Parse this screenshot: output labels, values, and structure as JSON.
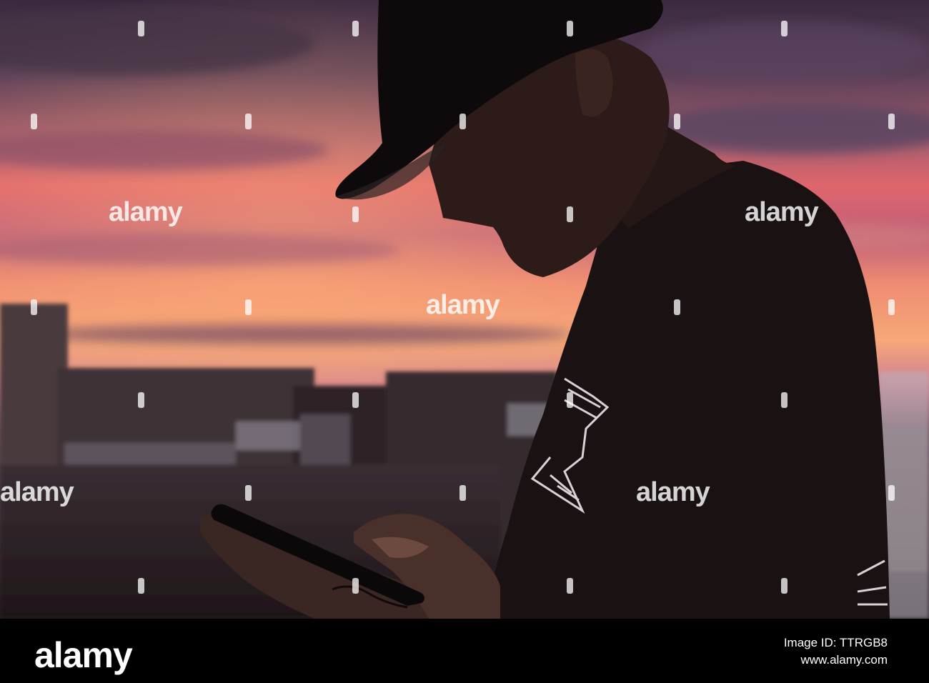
{
  "photo": {
    "watermark_text": "alamy",
    "colors": {
      "sky_top": "#3b2c40",
      "sky_pink": "#e0606a",
      "sky_orange": "#f2a070",
      "silhouette": "#1a1010",
      "skin_shadow": "#2a1a18"
    }
  },
  "footer": {
    "brand": "alamy",
    "image_id_line": "Image ID: TTRGB8",
    "url": "www.alamy.com"
  }
}
